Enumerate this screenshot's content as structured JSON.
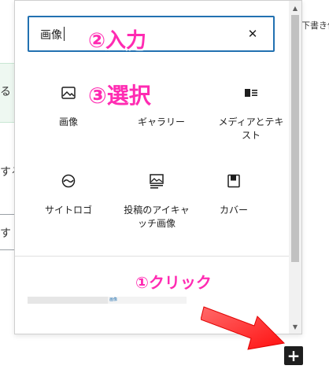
{
  "background": {
    "fragment_1": "る",
    "fragment_2": "する",
    "fragment_3": "す",
    "save_link": "下書き保存"
  },
  "inserter": {
    "search": {
      "value": "画像",
      "clear_icon": "close-icon"
    },
    "blocks": [
      {
        "label": "画像",
        "icon": "image-icon"
      },
      {
        "label": "ギャラリー",
        "icon": "gallery-icon"
      },
      {
        "label": "メディアとテキ\nスト",
        "icon": "media-text-icon"
      },
      {
        "label": "サイトロゴ",
        "icon": "site-logo-icon"
      },
      {
        "label": "投稿のアイキャ\nッチ画像",
        "icon": "featured-image-icon"
      },
      {
        "label": "カバー",
        "icon": "cover-icon"
      }
    ],
    "preview_text": "画像"
  },
  "annotations": {
    "step1": "①クリック",
    "step2": "②入力",
    "step3": "③選択",
    "color": "#ff2bb2"
  },
  "add_block_button": {
    "label": "+"
  },
  "colors": {
    "accent": "#2271b1",
    "arrow": "#ff1a1a"
  }
}
